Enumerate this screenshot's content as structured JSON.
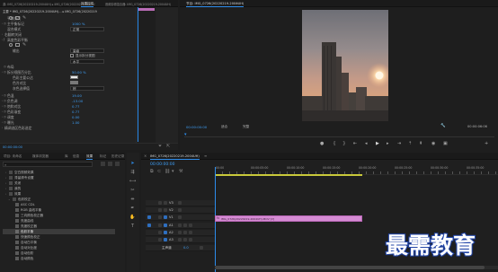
{
  "effect_controls": {
    "tabs": [
      "源: IMG_0726(20220219-2004UH) ▸ IMG_0726(20220219-2004U",
      "效果控件",
      "音频剪辑混合器: IMG_0726(20220219-2004UH)"
    ],
    "header": "主要 * IMG_0726(20220219-2004UH)... ▸ IMG_0726(20220219",
    "rows": [
      {
        "label": "平铺分类",
        "value": "",
        "kind": "icons"
      },
      {
        "label": "主平衡标记",
        "value": "1000 %",
        "kind": "val"
      },
      {
        "label": "混合模式",
        "value": "正常",
        "kind": "dropdown"
      },
      {
        "label": "右翻转关闭",
        "value": "",
        "kind": "text"
      },
      {
        "label": "高度色彩平衡",
        "value": "",
        "kind": "text"
      },
      {
        "label": "",
        "value": "",
        "kind": "icons"
      },
      {
        "label": "输出",
        "value": "量级",
        "kind": "dropdown"
      },
      {
        "label": "",
        "value": "显示拆分视图",
        "kind": "checkbox"
      },
      {
        "label": "",
        "value": "水平",
        "kind": "dropdown"
      },
      {
        "label": "布局",
        "value": "",
        "kind": "text"
      },
      {
        "label": "拆分视图百分比",
        "value": "50.00 %",
        "kind": "val"
      },
      {
        "label": "色彩主要公达",
        "value": "",
        "kind": "text"
      },
      {
        "label": "色冷对比",
        "value": "",
        "kind": "text"
      },
      {
        "label": "灰色选择值",
        "value": "棕",
        "kind": "dropdown"
      },
      {
        "label": "色温",
        "value": "19.00",
        "kind": "val"
      },
      {
        "label": "负色调",
        "value": "-13.00",
        "kind": "val"
      },
      {
        "label": "饱和对比",
        "value": "0.77",
        "kind": "val"
      },
      {
        "label": "色彩渐变",
        "value": "0.77",
        "kind": "val"
      },
      {
        "label": "调度",
        "value": "0.00",
        "kind": "val"
      },
      {
        "label": "曝光",
        "value": "1.00",
        "kind": "val"
      },
      {
        "label": "精调选区色彩选定",
        "value": "",
        "kind": "text"
      }
    ],
    "timecode": "00:00:00:00"
  },
  "program_monitor": {
    "tab": "节目: IMG_0726(20220219-2004UH)",
    "timecode": "00:00:00:00",
    "fit": "适合",
    "quality": "完整",
    "duration": "00:00:06:06",
    "controls": [
      "●",
      "|",
      "|",
      "◂◂",
      "◂",
      "▶",
      "▸",
      "▸▸",
      "⇤",
      "⇥",
      "▣",
      "⬚",
      "+"
    ]
  },
  "project": {
    "tabs": [
      "项目: 未命名",
      "媒体浏览器",
      "库",
      "信息",
      "效果",
      "标记",
      "历史记录"
    ],
    "search_placeholder": "",
    "items": [
      "空白视频效果",
      "滞留请专设置",
      "关闭",
      "我的",
      "效果",
      "色彩校正",
      "ASC CDL",
      "RGB 曲线平衡",
      "三向颜色校正器",
      "亮度曲线",
      "亮度校正器",
      "色彩平衡",
      "快速颜色校正",
      "自动白平衡",
      "自动对比度",
      "自动色阶",
      "自动颜色"
    ],
    "selected_index": 11
  },
  "timeline": {
    "tab": "IMG_0726(20220219-2004UH)",
    "timecode": "00:00:00:00",
    "ruler": [
      "00:00",
      "00:00:05:00",
      "00:00:10:00",
      "00:00:15:00",
      "00:00:20:00",
      "00:00:25:00",
      "00:00:30:00",
      "00:00:35:00"
    ],
    "tracks": [
      {
        "name": "V3",
        "kind": "video"
      },
      {
        "name": "V2",
        "kind": "video"
      },
      {
        "name": "V1",
        "kind": "video"
      },
      {
        "name": "A1",
        "kind": "audio"
      },
      {
        "name": "A2",
        "kind": "audio"
      },
      {
        "name": "A3",
        "kind": "audio"
      },
      {
        "name": "主声道",
        "kind": "master"
      }
    ],
    "master_value": "0.0",
    "clip": {
      "label": "IMG_0726(20220219-2004UH).MOV [V]",
      "track": "V1",
      "start_frac": 0.0,
      "end_frac": 0.52,
      "color": "#d58bd3"
    },
    "work_area_color": "#c9c93a"
  },
  "watermark": "最需教育",
  "colors": {
    "accent": "#2d8ceb",
    "clip": "#d58bd3",
    "work_area": "#c9c93a",
    "value_blue": "#3e9ff7"
  }
}
